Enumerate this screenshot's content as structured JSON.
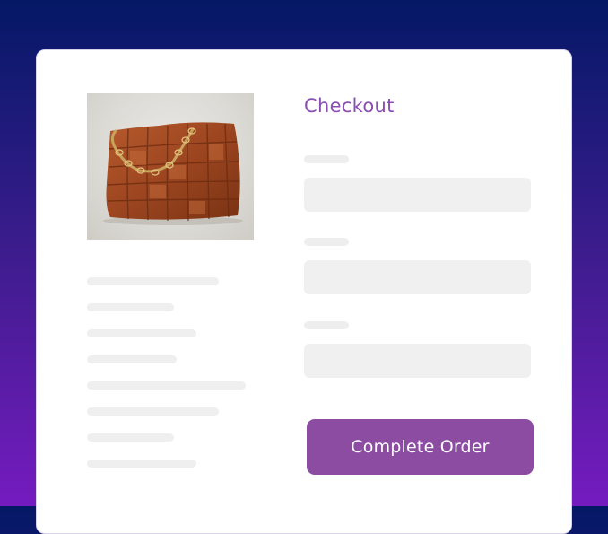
{
  "checkout": {
    "title": "Checkout",
    "complete_button_label": "Complete Order",
    "accent_color": "#8b4ca2",
    "title_color": "#8a4fb0"
  },
  "product": {
    "image_icon": "woven-leather-bag-photo"
  },
  "background": {
    "gradient_top": "#041865",
    "gradient_bottom": "#751bc0"
  }
}
